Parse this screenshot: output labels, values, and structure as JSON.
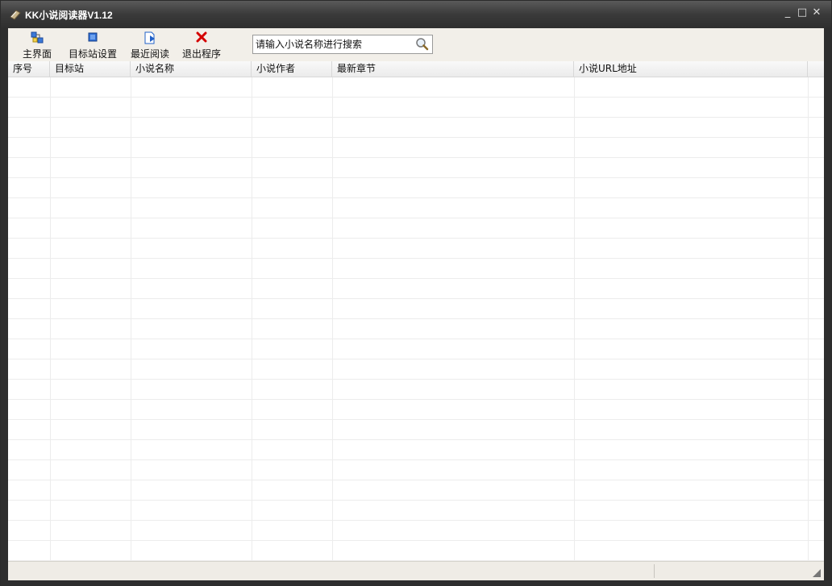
{
  "window": {
    "title": "KK小说阅读器V1.12",
    "controls": {
      "minimize": "_",
      "maximize": "□",
      "close": "✕"
    }
  },
  "toolbar": {
    "buttons": [
      {
        "label": "主界面",
        "icon": "home-windows-icon"
      },
      {
        "label": "目标站设置",
        "icon": "target-square-icon"
      },
      {
        "label": "最近阅读",
        "icon": "recent-read-icon"
      },
      {
        "label": "退出程序",
        "icon": "exit-x-icon"
      }
    ]
  },
  "search": {
    "placeholder": "请输入小说名称进行搜索",
    "icon": "magnifier-icon"
  },
  "table": {
    "columns": [
      "序号",
      "目标站",
      "小说名称",
      "小说作者",
      "最新章节",
      "小说URL地址"
    ],
    "rows": []
  },
  "colors": {
    "titlebar": "#3a3a3a",
    "toolbar": "#f2efe9",
    "exit_red": "#d40000",
    "icon_blue": "#2060c8"
  }
}
